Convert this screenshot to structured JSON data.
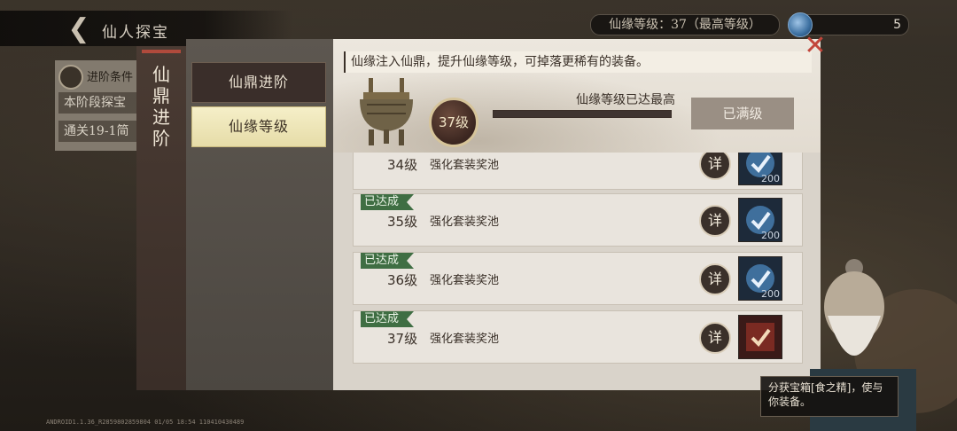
{
  "header": {
    "back_icon": "back-arrow-icon",
    "title": "仙人探宝",
    "level_status": "仙缘等级：37（最高等级）",
    "currency_value": "5",
    "currency_icon": "blue-orb-icon"
  },
  "side_card": {
    "line1": "进阶条件",
    "line2": "本阶段探宝",
    "line3": "通关19-1简"
  },
  "modal": {
    "vertical_title": "仙鼎进阶",
    "menu": [
      {
        "label": "仙鼎进阶",
        "active": false
      },
      {
        "label": "仙缘等级",
        "active": true
      }
    ],
    "notice": "仙缘注入仙鼎，提升仙缘等级，可掉落更稀有的装备。",
    "current_level": "37级",
    "progress_label": "仙缘等级已达最高",
    "progress_fraction": 1.0,
    "maxed_button": "已满级",
    "rows": [
      {
        "badge": "",
        "level": "34级",
        "desc": "强化套装奖池",
        "detail": "详",
        "count": "200",
        "icon": "blue-check-icon"
      },
      {
        "badge": "已达成",
        "level": "35级",
        "desc": "强化套装奖池",
        "detail": "详",
        "count": "200",
        "icon": "blue-check-icon"
      },
      {
        "badge": "已达成",
        "level": "36级",
        "desc": "强化套装奖池",
        "detail": "详",
        "count": "200",
        "icon": "blue-check-icon"
      },
      {
        "badge": "已达成",
        "level": "37级",
        "desc": "强化套装奖池",
        "detail": "详",
        "count": "",
        "icon": "red-check-icon"
      }
    ],
    "close_icon": "close-x-icon"
  },
  "npc": {
    "speech": "分获宝箱[食之精]，使与你装备。"
  },
  "build_info": "ANDROID1.1.36_R2859802859804 01/05 18:54 110410430489",
  "colors": {
    "badge_green": "#3f6e43",
    "active_tab": "#f5efc8",
    "close_red": "#c2453a"
  }
}
